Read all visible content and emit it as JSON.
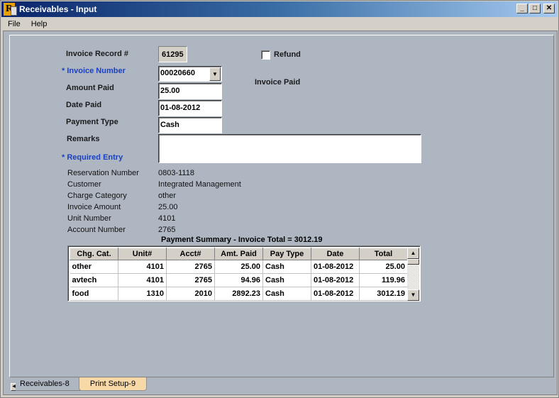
{
  "window": {
    "title": "Receivables - Input",
    "app_icon": "R",
    "controls": {
      "minimize": "_",
      "maximize": "□",
      "close": "✕"
    }
  },
  "menu": [
    "File",
    "Help"
  ],
  "form": {
    "invoice_record": {
      "label": "Invoice Record #",
      "value": "61295"
    },
    "refund": {
      "label": "Refund",
      "checked": false
    },
    "invoice_number": {
      "label": "* Invoice Number",
      "value": "00020660"
    },
    "invoice_status": "Invoice Paid",
    "amount_paid": {
      "label": "Amount Paid",
      "value": "25.00"
    },
    "date_paid": {
      "label": "Date Paid",
      "value": "01-08-2012"
    },
    "payment_type": {
      "label": "Payment Type",
      "value": "Cash"
    },
    "remarks": {
      "label": "Remarks",
      "value": ""
    },
    "required_note": "* Required Entry"
  },
  "details": [
    {
      "label": "Reservation Number",
      "value": "0803-1118"
    },
    {
      "label": "Customer",
      "value": "Integrated Management"
    },
    {
      "label": "Charge Category",
      "value": "other"
    },
    {
      "label": "Invoice Amount",
      "value": "25.00"
    },
    {
      "label": "Unit Number",
      "value": "4101"
    },
    {
      "label": "Account Number",
      "value": "2765"
    }
  ],
  "summary": {
    "title": "Payment Summary - Invoice Total = 3012.19",
    "columns": [
      "Chg. Cat.",
      "Unit#",
      "Acct#",
      "Amt. Paid",
      "Pay Type",
      "Date",
      "Total"
    ],
    "rows": [
      [
        "other",
        "4101",
        "2765",
        "25.00",
        "Cash",
        "01-08-2012",
        "25.00"
      ],
      [
        "avtech",
        "4101",
        "2765",
        "94.96",
        "Cash",
        "01-08-2012",
        "119.96"
      ],
      [
        "food",
        "1310",
        "2010",
        "2892.23",
        "Cash",
        "01-08-2012",
        "3012.19"
      ],
      [
        "",
        "",
        "",
        "",
        "",
        "",
        ""
      ]
    ]
  },
  "tabs": [
    {
      "label": "Receivables-8",
      "active": true
    },
    {
      "label": "Print Setup-9",
      "active": false
    }
  ]
}
